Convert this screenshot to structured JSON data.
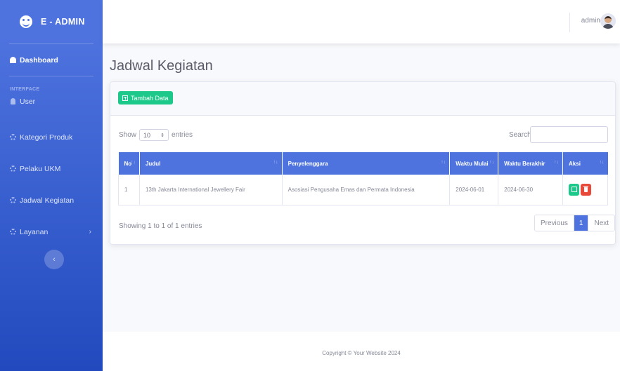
{
  "brand": {
    "name": "E - ADMIN"
  },
  "sidebar": {
    "dashboard_label": "Dashboard",
    "heading": "INTERFACE",
    "items": [
      {
        "label": "User"
      },
      {
        "label": "Kategori Produk"
      },
      {
        "label": "Pelaku UKM"
      },
      {
        "label": "Jadwal Kegiatan"
      },
      {
        "label": "Layanan"
      }
    ],
    "toggle_icon": "‹"
  },
  "topbar": {
    "user_name": "admin"
  },
  "page": {
    "title": "Jadwal Kegiatan"
  },
  "toolbar": {
    "add_label": "Tambah Data"
  },
  "table_controls": {
    "show_label": "Show",
    "entries_value": "10",
    "entries_label": "entries",
    "search_label": "Search:",
    "search_value": ""
  },
  "table": {
    "headers": [
      "No",
      "Judul",
      "Penyelenggara",
      "Waktu Mulai",
      "Waktu Berakhir",
      "Aksi"
    ],
    "rows": [
      {
        "no": "1",
        "judul": "13th Jakarta International Jewellery Fair",
        "penyelenggara": "Asosiasi Pengusaha Emas dan Permata Indonesia",
        "waktu_mulai": "2024-06-01",
        "waktu_berakhir": "2024-06-30"
      }
    ]
  },
  "pagination": {
    "info": "Showing 1 to 1 of 1 entries",
    "previous": "Previous",
    "current": "1",
    "next": "Next"
  },
  "footer": {
    "copyright": "Copyright © Your Website 2024"
  },
  "colors": {
    "primary": "#4e73df",
    "success": "#1cc88a",
    "danger": "#e74a3b"
  }
}
